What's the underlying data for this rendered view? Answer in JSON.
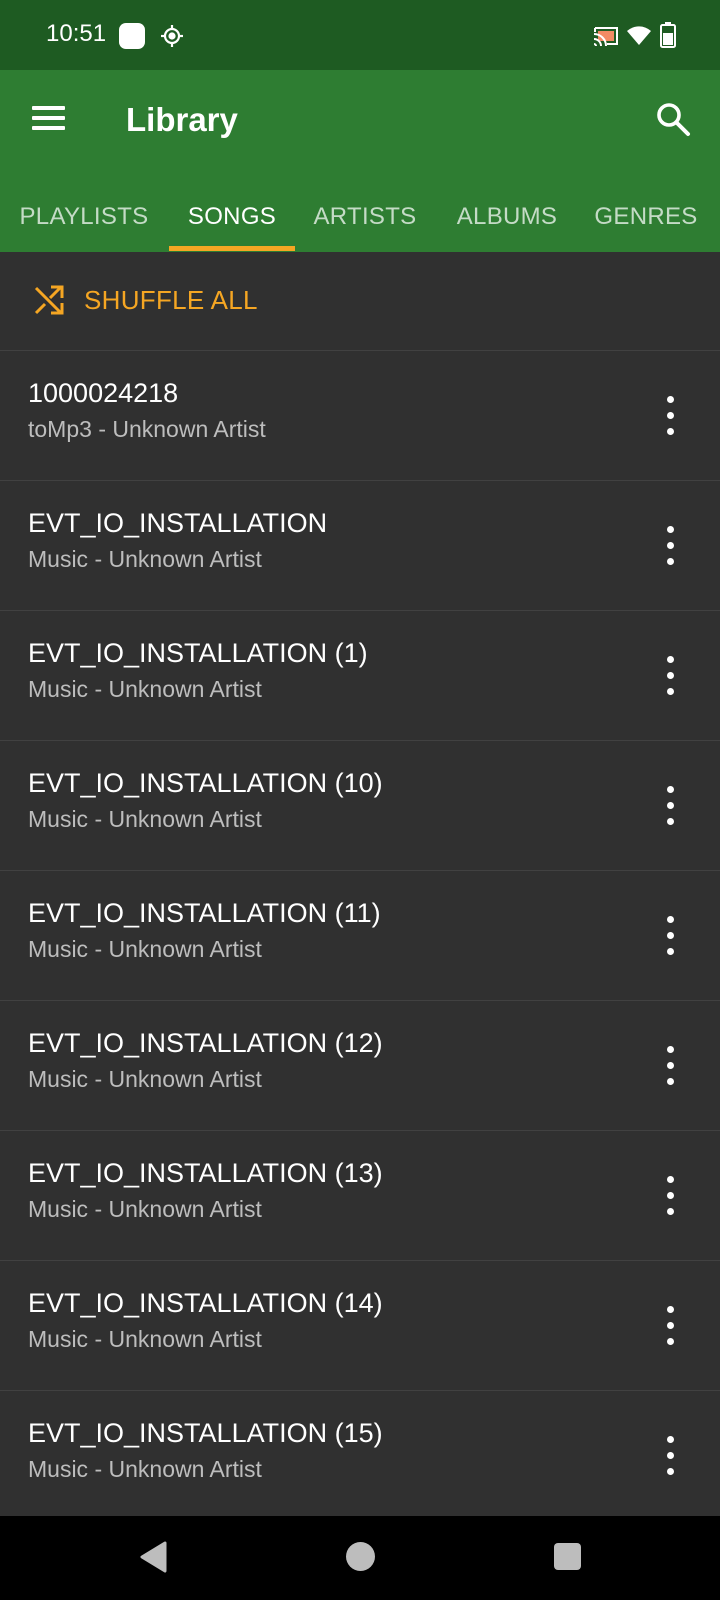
{
  "status_bar": {
    "time": "10:51",
    "icons": [
      "notification-icon",
      "gps-icon",
      "cast-icon",
      "wifi-icon",
      "battery-icon"
    ]
  },
  "app_bar": {
    "title": "Library",
    "menu_icon": "menu-icon",
    "search_icon": "search-icon",
    "color": "#2e7d32"
  },
  "tabs": [
    {
      "label": "PLAYLISTS",
      "active": false
    },
    {
      "label": "SONGS",
      "active": true
    },
    {
      "label": "ARTISTS",
      "active": false
    },
    {
      "label": "ALBUMS",
      "active": false
    },
    {
      "label": "GENRES",
      "active": false
    }
  ],
  "shuffle": {
    "label": "SHUFFLE ALL",
    "icon": "shuffle-icon",
    "color": "#f5a623"
  },
  "songs": [
    {
      "title": "1000024218",
      "subtitle": "toMp3 - Unknown Artist"
    },
    {
      "title": "EVT_IO_INSTALLATION",
      "subtitle": "Music - Unknown Artist"
    },
    {
      "title": "EVT_IO_INSTALLATION (1)",
      "subtitle": "Music - Unknown Artist"
    },
    {
      "title": "EVT_IO_INSTALLATION (10)",
      "subtitle": "Music - Unknown Artist"
    },
    {
      "title": "EVT_IO_INSTALLATION (11)",
      "subtitle": "Music - Unknown Artist"
    },
    {
      "title": "EVT_IO_INSTALLATION (12)",
      "subtitle": "Music - Unknown Artist"
    },
    {
      "title": "EVT_IO_INSTALLATION (13)",
      "subtitle": "Music - Unknown Artist"
    },
    {
      "title": "EVT_IO_INSTALLATION (14)",
      "subtitle": "Music - Unknown Artist"
    },
    {
      "title": "EVT_IO_INSTALLATION (15)",
      "subtitle": "Music - Unknown Artist"
    }
  ],
  "nav_bar": {
    "icons": [
      "back-icon",
      "home-icon",
      "recents-icon"
    ]
  }
}
